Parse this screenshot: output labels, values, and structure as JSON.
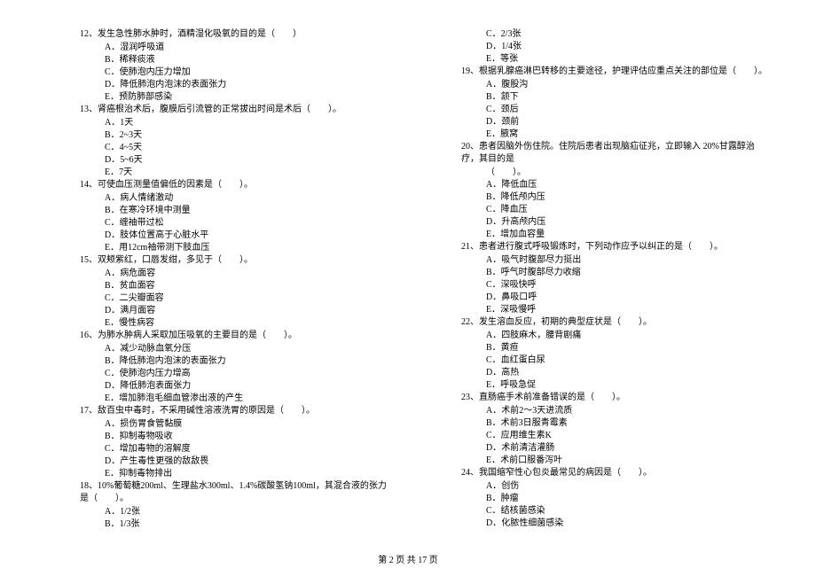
{
  "left": [
    {
      "type": "q",
      "text": "12、发生急性肺水肿时，酒精湿化吸氧的目的是（　　）"
    },
    {
      "type": "opt",
      "text": "A．湿润呼吸道"
    },
    {
      "type": "opt",
      "text": "B．稀释痰液"
    },
    {
      "type": "opt",
      "text": "C．使肺泡内压力增加"
    },
    {
      "type": "opt",
      "text": "D．降低肺泡内泡沫的表面张力"
    },
    {
      "type": "opt",
      "text": "E．预防肺部感染"
    },
    {
      "type": "q",
      "text": "13、肾癌根治术后，腹膜后引流管的正常拔出时间是术后（　　）。"
    },
    {
      "type": "opt",
      "text": "A．1天"
    },
    {
      "type": "opt",
      "text": "B．2~3天"
    },
    {
      "type": "opt",
      "text": "C．4~5天"
    },
    {
      "type": "opt",
      "text": "D．5~6天"
    },
    {
      "type": "opt",
      "text": "E．7天"
    },
    {
      "type": "q",
      "text": "14、可使血压测量值偏低的因素是（　　）。"
    },
    {
      "type": "opt",
      "text": "A．病人情绪激动"
    },
    {
      "type": "opt",
      "text": "B．在寒冷环境中测量"
    },
    {
      "type": "opt",
      "text": "C．缠袖带过松"
    },
    {
      "type": "opt",
      "text": "D．肢体位置高于心脏水平"
    },
    {
      "type": "opt",
      "text": "E．用12cm袖带测下肢血压"
    },
    {
      "type": "q",
      "text": "15、双颊紫红，口唇发绀，多见于（　　）。"
    },
    {
      "type": "opt",
      "text": "A．病危面容"
    },
    {
      "type": "opt",
      "text": "B．贫血面容"
    },
    {
      "type": "opt",
      "text": "C．二尖瓣面容"
    },
    {
      "type": "opt",
      "text": "D．满月面容"
    },
    {
      "type": "opt",
      "text": "E．慢性病容"
    },
    {
      "type": "q",
      "text": "16、为肺水肿病人采取加压吸氧的主要目的是（　　）。"
    },
    {
      "type": "opt",
      "text": "A．减少动脉血氧分压"
    },
    {
      "type": "opt",
      "text": "B．降低肺泡内泡沫的表面张力"
    },
    {
      "type": "opt",
      "text": "C．使肺泡内压力增高"
    },
    {
      "type": "opt",
      "text": "D．降低肺泡表面张力"
    },
    {
      "type": "opt",
      "text": "E．增加肺泡毛细血管渗出液的产生"
    },
    {
      "type": "q",
      "text": "17、敌百虫中毒时，不采用碱性溶液洗胃的原因是（　　）。"
    },
    {
      "type": "opt",
      "text": "A．损伤胃食管黏膜"
    },
    {
      "type": "opt",
      "text": "B．抑制毒物吸收"
    },
    {
      "type": "opt",
      "text": "C．增加毒物的溶解度"
    },
    {
      "type": "opt",
      "text": "D．产生毒性更强的敌敌畏"
    },
    {
      "type": "opt",
      "text": "E．抑制毒物排出"
    },
    {
      "type": "q",
      "text": "18、10%葡萄糖200ml、生理盐水300ml、1.4%碳酸氢钠100ml，其混合液的张力是（　　）。"
    },
    {
      "type": "opt",
      "text": "A．1/2张"
    },
    {
      "type": "opt",
      "text": "B．1/3张"
    }
  ],
  "right": [
    {
      "type": "opt",
      "text": "C．2/3张"
    },
    {
      "type": "opt",
      "text": "D．1/4张"
    },
    {
      "type": "opt",
      "text": "E．等张"
    },
    {
      "type": "q",
      "text": "19、根据乳腺癌淋巴转移的主要途径，护理评估应重点关注的部位是（　　）。"
    },
    {
      "type": "opt",
      "text": "A．腹股沟"
    },
    {
      "type": "opt",
      "text": "B．颔下"
    },
    {
      "type": "opt",
      "text": "C．颈后"
    },
    {
      "type": "opt",
      "text": "D．颈前"
    },
    {
      "type": "opt",
      "text": "E．腋窝"
    },
    {
      "type": "q",
      "text": "20、患者因脑外伤住院。住院后患者出现脑疝征兆，立即输入 20%甘露醇治疗，其目的是"
    },
    {
      "type": "sub",
      "text": "（　　）。"
    },
    {
      "type": "opt",
      "text": "A．降低血压"
    },
    {
      "type": "opt",
      "text": "B．降低颅内压"
    },
    {
      "type": "opt",
      "text": "C．降血压"
    },
    {
      "type": "opt",
      "text": "D．升高颅内压"
    },
    {
      "type": "opt",
      "text": "E．增加血容量"
    },
    {
      "type": "q",
      "text": "21、患者进行腹式呼吸锻炼时，下列动作应予以纠正的是（　　）。"
    },
    {
      "type": "opt",
      "text": "A．吸气时腹部尽力挺出"
    },
    {
      "type": "opt",
      "text": "B．呼气时腹部尽力收缩"
    },
    {
      "type": "opt",
      "text": "C．深吸快呼"
    },
    {
      "type": "opt",
      "text": "D．鼻吸口呼"
    },
    {
      "type": "opt",
      "text": "E．深吸慢呼"
    },
    {
      "type": "q",
      "text": "22、发生溶血反应，初期的典型症状是（　　）。"
    },
    {
      "type": "opt",
      "text": "A．四肢麻木，腰背剧痛"
    },
    {
      "type": "opt",
      "text": "B．黄疸"
    },
    {
      "type": "opt",
      "text": "C．血红蛋白尿"
    },
    {
      "type": "opt",
      "text": "D．高热"
    },
    {
      "type": "opt",
      "text": "E．呼吸急促"
    },
    {
      "type": "q",
      "text": "23、直肠癌手术前准备错误的是（　　）。"
    },
    {
      "type": "opt",
      "text": "A．术前2～3天进流质"
    },
    {
      "type": "opt",
      "text": "B．术前3日服青霉素"
    },
    {
      "type": "opt",
      "text": "C．应用维生素K"
    },
    {
      "type": "opt",
      "text": "D．术前清洁灌肠"
    },
    {
      "type": "opt",
      "text": "E．术前口服番泻叶"
    },
    {
      "type": "q",
      "text": "24、我国缩窄性心包炎最常见的病因是（　　）。"
    },
    {
      "type": "opt",
      "text": "A．创伤"
    },
    {
      "type": "opt",
      "text": "B．肿瘤"
    },
    {
      "type": "opt",
      "text": "C．结核菌感染"
    },
    {
      "type": "opt",
      "text": "D．化脓性细菌感染"
    }
  ],
  "footer": "第 2 页 共 17 页"
}
